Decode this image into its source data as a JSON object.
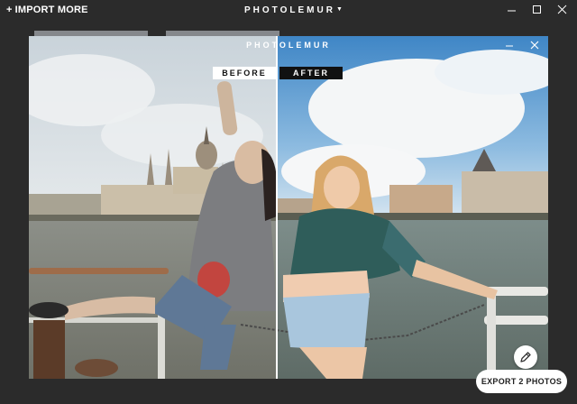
{
  "topbar": {
    "import_label": "IMPORT MORE",
    "import_icon": "plus-icon",
    "app_title": "PHOTOLEMUR",
    "title_caret_icon": "caret-down-icon",
    "window_controls": [
      "minimize-icon",
      "maximize-icon",
      "close-icon"
    ]
  },
  "preview": {
    "watermark_title": "PHOTOLEMUR",
    "before_label": "BEFORE",
    "after_label": "AFTER",
    "edit_icon": "pencil-icon",
    "split_fraction": 0.477
  },
  "footer": {
    "export_label": "EXPORT 2 PHOTOS"
  },
  "colors": {
    "app_background": "#2b2b2b",
    "after_label_bg": "#111111",
    "before_label_bg": "#ffffff"
  }
}
